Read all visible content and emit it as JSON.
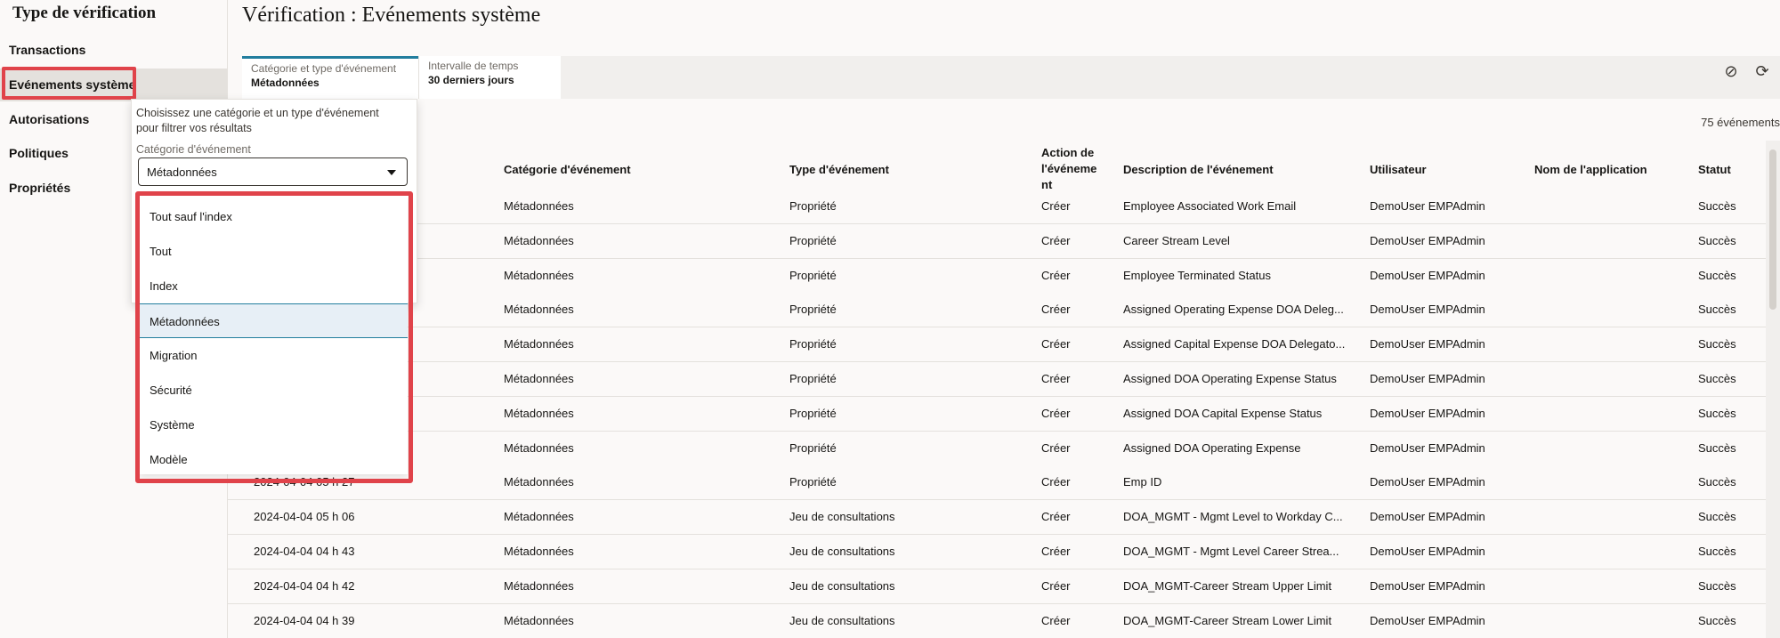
{
  "sidebar": {
    "title": "Type de vérification",
    "items": [
      {
        "label": "Transactions"
      },
      {
        "label": "Evénements système"
      },
      {
        "label": "Autorisations"
      },
      {
        "label": "Politiques"
      },
      {
        "label": "Propriétés"
      }
    ]
  },
  "page": {
    "title": "Vérification : Evénements système"
  },
  "filters": {
    "category": {
      "label": "Catégorie et type d'événement",
      "value": "Métadonnées"
    },
    "time": {
      "label": "Intervalle de temps",
      "value": "30 derniers jours"
    }
  },
  "toolbar": {
    "clear_icon": "⊘",
    "refresh_icon": "⟳"
  },
  "results_count": "75 événements",
  "popup": {
    "help_line1": "Choisissez une catégorie et un type d'événement",
    "help_line2": "pour filtrer vos résultats",
    "category_label": "Catégorie d'événement",
    "category_value": "Métadonnées",
    "options": [
      "Tout sauf l'index",
      "Tout",
      "Index",
      "Métadonnées",
      "Migration",
      "Sécurité",
      "Système",
      "Modèle"
    ],
    "selected_option": "Métadonnées"
  },
  "table": {
    "headers": {
      "category": "Catégorie d'événement",
      "type": "Type d'événement",
      "action_l1": "Action de",
      "action_l2": "l'événeme",
      "action_l3": "nt",
      "description": "Description de l'événement",
      "user": "Utilisateur",
      "app": "Nom de l'application",
      "status": "Statut"
    },
    "rows": [
      {
        "date": "",
        "category": "Métadonnées",
        "type": "Propriété",
        "action": "Créer",
        "description": "Employee Associated Work Email",
        "user": "DemoUser EMPAdmin",
        "app": "",
        "status": "Succès"
      },
      {
        "date": "",
        "category": "Métadonnées",
        "type": "Propriété",
        "action": "Créer",
        "description": "Career Stream Level",
        "user": "DemoUser EMPAdmin",
        "app": "",
        "status": "Succès"
      },
      {
        "date": "",
        "category": "Métadonnées",
        "type": "Propriété",
        "action": "Créer",
        "description": "Employee Terminated Status",
        "user": "DemoUser EMPAdmin",
        "app": "",
        "status": "Succès"
      },
      {
        "date": "",
        "category": "Métadonnées",
        "type": "Propriété",
        "action": "Créer",
        "description": "Assigned Operating Expense DOA Deleg...",
        "user": "DemoUser EMPAdmin",
        "app": "",
        "status": "Succès"
      },
      {
        "date": "",
        "category": "Métadonnées",
        "type": "Propriété",
        "action": "Créer",
        "description": "Assigned Capital Expense DOA Delegato...",
        "user": "DemoUser EMPAdmin",
        "app": "",
        "status": "Succès"
      },
      {
        "date": "",
        "category": "Métadonnées",
        "type": "Propriété",
        "action": "Créer",
        "description": "Assigned DOA Operating Expense Status",
        "user": "DemoUser EMPAdmin",
        "app": "",
        "status": "Succès"
      },
      {
        "date": "",
        "category": "Métadonnées",
        "type": "Propriété",
        "action": "Créer",
        "description": "Assigned DOA Capital Expense Status",
        "user": "DemoUser EMPAdmin",
        "app": "",
        "status": "Succès"
      },
      {
        "date": "",
        "category": "Métadonnées",
        "type": "Propriété",
        "action": "Créer",
        "description": "Assigned DOA Operating Expense",
        "user": "DemoUser EMPAdmin",
        "app": "",
        "status": "Succès"
      },
      {
        "date": "2024-04-04 05 h 27",
        "category": "Métadonnées",
        "type": "Propriété",
        "action": "Créer",
        "description": "Emp ID",
        "user": "DemoUser EMPAdmin",
        "app": "",
        "status": "Succès"
      },
      {
        "date": "2024-04-04 05 h 06",
        "category": "Métadonnées",
        "type": "Jeu de consultations",
        "action": "Créer",
        "description": "DOA_MGMT - Mgmt Level to Workday C...",
        "user": "DemoUser EMPAdmin",
        "app": "",
        "status": "Succès"
      },
      {
        "date": "2024-04-04 04 h 43",
        "category": "Métadonnées",
        "type": "Jeu de consultations",
        "action": "Créer",
        "description": "DOA_MGMT - Mgmt Level Career Strea...",
        "user": "DemoUser EMPAdmin",
        "app": "",
        "status": "Succès"
      },
      {
        "date": "2024-04-04 04 h 42",
        "category": "Métadonnées",
        "type": "Jeu de consultations",
        "action": "Créer",
        "description": "DOA_MGMT-Career Stream Upper Limit",
        "user": "DemoUser EMPAdmin",
        "app": "",
        "status": "Succès"
      },
      {
        "date": "2024-04-04 04 h 39",
        "category": "Métadonnées",
        "type": "Jeu de consultations",
        "action": "Créer",
        "description": "DOA_MGMT-Career Stream Lower Limit",
        "user": "DemoUser EMPAdmin",
        "app": "",
        "status": "Succès"
      }
    ]
  },
  "colors": {
    "accent": "#227e9e",
    "highlight": "#e0434a",
    "selected_bg": "#e7eff6"
  }
}
